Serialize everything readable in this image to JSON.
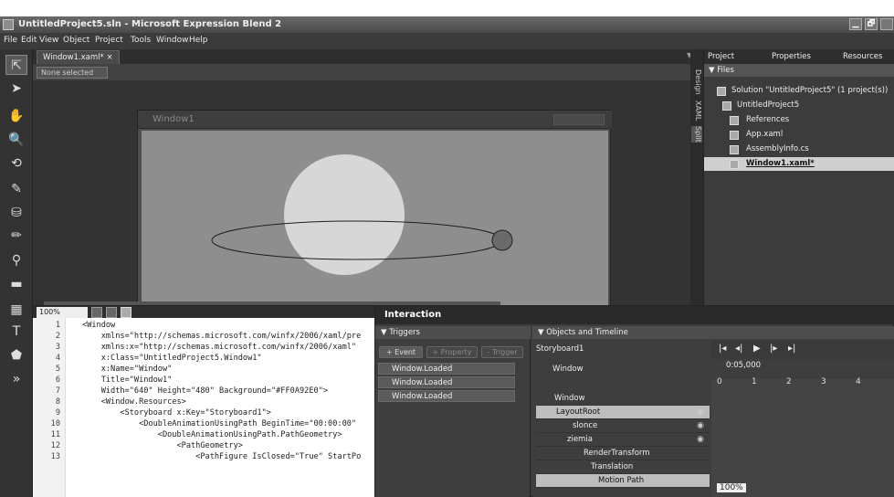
{
  "title_bar": {
    "title": "UntitledProject5.sln - Microsoft Expression Blend 2",
    "min": "▁",
    "max": "🗗"
  },
  "menu": [
    "File",
    "Edit",
    "View",
    "Object",
    "Project",
    "Tools",
    "Window",
    "Help"
  ],
  "document_tab": "Window1.xaml* ×",
  "breadcrumb_selector": "None selected",
  "artboard": {
    "window_title": "Window1"
  },
  "view_bar": {
    "zoom": "100%"
  },
  "code": {
    "line_numbers": [
      "1",
      "2",
      "3",
      "4",
      "5",
      "6",
      "7",
      "8",
      "9",
      "10",
      "11",
      "12",
      "13"
    ],
    "lines": [
      "<Window",
      "    xmlns=\"http://schemas.microsoft.com/winfx/2006/xaml/pre",
      "    xmlns:x=\"http://schemas.microsoft.com/winfx/2006/xaml\"",
      "    x:Class=\"UntitledProject5.Window1\"",
      "    x:Name=\"Window\"",
      "    Title=\"Window1\"",
      "    Width=\"640\" Height=\"480\" Background=\"#FF0A92E0\">",
      "    <Window.Resources>",
      "        <Storyboard x:Key=\"Storyboard1\">",
      "            <DoubleAnimationUsingPath BeginTime=\"00:00:00\"",
      "                <DoubleAnimationUsingPath.PathGeometry>",
      "                    <PathGeometry>",
      "                        <PathFigure IsClosed=\"True\" StartPo"
    ]
  },
  "side_strip": {
    "design": "Design",
    "xaml": "XAML",
    "split": "Split"
  },
  "right_panel": {
    "tabs": [
      "Project",
      "Properties",
      "Resources"
    ],
    "files_header": "▼ Files",
    "tree": [
      {
        "label": "Solution \"UntitledProject5\" (1 project(s))",
        "indent": 0
      },
      {
        "label": "UntitledProject5",
        "indent": 1
      },
      {
        "label": "References",
        "indent": 2
      },
      {
        "label": "App.xaml",
        "indent": 2
      },
      {
        "label": "AssemblyInfo.cs",
        "indent": 2
      },
      {
        "label": "Window1.xaml*",
        "indent": 2,
        "selected": true
      }
    ]
  },
  "interaction": {
    "title": "Interaction",
    "triggers_header": "▼ Triggers",
    "event_btn": "+ Event",
    "property_btn": "+ Property",
    "trigger_btn": "- Trigger",
    "trigger_items": [
      "Window.Loaded",
      "Window.Loaded",
      "Window.Loaded"
    ],
    "objects_header": "▼ Objects and Timeline",
    "storyboard": "Storyboard1",
    "window_label": "Window",
    "time": "0:05,000",
    "ticks": [
      "0",
      "1",
      "2",
      "3",
      "4"
    ],
    "timeline_zoom": "100%",
    "objects": [
      {
        "label": "Window"
      },
      {
        "label": "LayoutRoot",
        "selected": true
      },
      {
        "label": "slonce"
      },
      {
        "label": "ziemia"
      },
      {
        "label": "RenderTransform"
      },
      {
        "label": "Translation"
      },
      {
        "label": "Motion Path"
      }
    ]
  }
}
